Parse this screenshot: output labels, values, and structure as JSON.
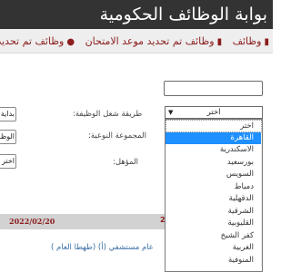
{
  "header": {
    "title": "بوابة الوظائف الحكومية"
  },
  "nav": {
    "items": [
      {
        "label": "وظائف"
      },
      {
        "label": "وظائف تم تحديد موعد الامتحان"
      },
      {
        "label": "وظائف تم تحديد مو"
      }
    ]
  },
  "search": {
    "value": ""
  },
  "form": {
    "work_method_label": "طريقة شغل الوظيفة:",
    "work_method_value": "بداية",
    "group_label": "المجموعة النوعية:",
    "group_value": "الوظا",
    "qualification_label": "المؤهل:",
    "qualification_value": "اختر"
  },
  "dropdown": {
    "selected": "اختر",
    "options": [
      "اختر",
      "القاهرة",
      "الاسكندرية",
      "بورسعيد",
      "السويس",
      "دمياط",
      "الدقهلية",
      "الشرقية",
      "القليوبية",
      "كفر الشيخ",
      "الغربية",
      "المنوفية"
    ],
    "highlighted_index": 1
  },
  "listing": {
    "date": "2022/02/20",
    "date_marker": "2",
    "link_text": "عام مستشفي (أ) (طهطا العام )"
  },
  "colors": {
    "header_bg": "#333333",
    "accent": "#8b1d1d",
    "highlight": "#1e90ff",
    "link": "#3a6fa8"
  }
}
